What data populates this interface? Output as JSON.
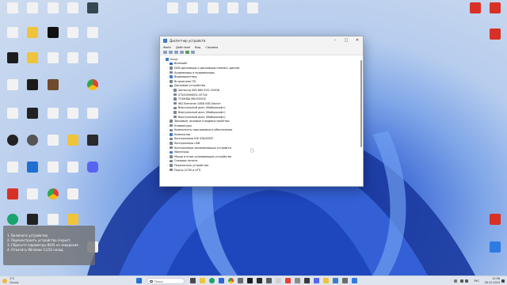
{
  "desktop": {
    "icons": [
      {
        "label": "",
        "color": "#f4f4f4"
      },
      {
        "label": "",
        "color": "#f4f4f4"
      },
      {
        "label": "",
        "color": "#f4f4f4"
      },
      {
        "label": "",
        "color": "#37474f"
      },
      {
        "label": "",
        "color": "#f4f4f4"
      },
      {
        "label": "",
        "color": "#f4f4f4"
      },
      {
        "label": "",
        "color": "#f4f4f4"
      },
      {
        "label": "",
        "color": "#f4f4f4"
      },
      {
        "label": "",
        "color": "#f4f4f4"
      }
    ]
  },
  "window": {
    "title": "Диспетчер устройств",
    "menu": [
      "Файл",
      "Действие",
      "Вид",
      "Справка"
    ],
    "tree": [
      {
        "level": 0,
        "exp": "⌄",
        "label": "msup",
        "color": "#3d7cc9"
      },
      {
        "level": 1,
        "exp": "›",
        "label": "Bluetooth",
        "color": "#2a64d0"
      },
      {
        "level": 1,
        "exp": "›",
        "label": "DVD-дисководы и дисководы компакт-дисков",
        "color": "#7d8794"
      },
      {
        "level": 1,
        "exp": "›",
        "label": "Аудиовходы и аудиовыходы",
        "color": "#7d8794"
      },
      {
        "level": 1,
        "exp": "›",
        "label": "Видеоадаптеры",
        "color": "#4a7fc6"
      },
      {
        "level": 1,
        "exp": "›",
        "label": "Встроенное ПО",
        "color": "#7d8794"
      },
      {
        "level": 1,
        "exp": "⌄",
        "label": "Дисковые устройства",
        "color": "#7d8794"
      },
      {
        "level": 2,
        "exp": "",
        "label": "Samsung SSD 860 EVO 250GB",
        "color": "#7d8794"
      },
      {
        "level": 2,
        "exp": "",
        "label": "ST2000VM002-1ET16",
        "color": "#7d8794"
      },
      {
        "level": 2,
        "exp": "",
        "label": "TOSHIBA MK2555GS",
        "color": "#7d8794"
      },
      {
        "level": 2,
        "exp": "",
        "label": "WD Elements 10B8 USB Device",
        "color": "#7d8794"
      },
      {
        "level": 2,
        "exp": "",
        "label": "Виртуальный диск (Майкрософт)",
        "color": "#7d8794"
      },
      {
        "level": 2,
        "exp": "",
        "label": "Виртуальный диск (Майкрософт)",
        "color": "#7d8794"
      },
      {
        "level": 2,
        "exp": "",
        "label": "Виртуальный диск (Майкрософт)",
        "color": "#7d8794"
      },
      {
        "level": 1,
        "exp": "›",
        "label": "Звуковые, игровые и видеоустройства",
        "color": "#7d8794"
      },
      {
        "level": 1,
        "exp": "›",
        "label": "Клавиатуры",
        "color": "#7d8794"
      },
      {
        "level": 1,
        "exp": "›",
        "label": "Компоненты программного обеспечения",
        "color": "#7d8794"
      },
      {
        "level": 1,
        "exp": "›",
        "label": "Компьютер",
        "color": "#4a7fc6"
      },
      {
        "level": 1,
        "exp": "›",
        "label": "Контроллеры IDE ATA/ATAPI",
        "color": "#7d8794"
      },
      {
        "level": 1,
        "exp": "›",
        "label": "Контроллеры USB",
        "color": "#7d8794"
      },
      {
        "level": 1,
        "exp": "›",
        "label": "Контроллеры запоминающих устройств",
        "color": "#7d8794"
      },
      {
        "level": 1,
        "exp": "›",
        "label": "Мониторы",
        "color": "#4a7fc6"
      },
      {
        "level": 1,
        "exp": "›",
        "label": "Мыши и иные указывающие устройства",
        "color": "#7d8794"
      },
      {
        "level": 1,
        "exp": "›",
        "label": "Очереди печати",
        "color": "#7d8794"
      },
      {
        "level": 1,
        "exp": "›",
        "label": "Переносные устройства",
        "color": "#7d8794"
      },
      {
        "level": 1,
        "exp": "›",
        "label": "Порты (COM и LPT)",
        "color": "#7d8794"
      }
    ]
  },
  "notes": [
    "1. Включите устройство",
    "2. Перенастроить устройство (скрыт)",
    "3. Сбросьте параметры BIOS на заводские",
    "4. Откатить Windows 11/10 назад"
  ],
  "taskbar": {
    "temp": "1°C",
    "condition": "Cloudy",
    "search_placeholder": "Поиск",
    "lang": "РУС",
    "time": "12:56",
    "date": "26.12.2023"
  }
}
